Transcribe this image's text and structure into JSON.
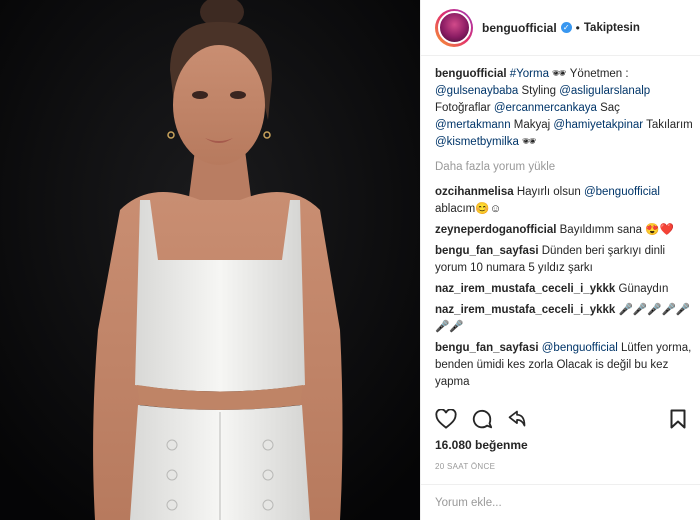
{
  "post": {
    "username": "benguofficial",
    "follow_status": "Takiptesin",
    "separator": "•"
  },
  "caption": {
    "username": "benguofficial",
    "parts": [
      "#Yorma",
      " 🕶 Yönetmen : ",
      "@gulsenaybaba",
      " Styling ",
      "@asligularslanalp",
      " Fotoğraflar ",
      "@ercanmercankaya",
      " Saç ",
      "@mertakmann",
      " Makyaj ",
      "@hamiyetakpinar",
      " Takılarım ",
      "@kismetbymilka",
      " 🕶"
    ]
  },
  "load_more": "Daha fazla yorum yükle",
  "comments": [
    {
      "user": "ozcihanmelisa",
      "text": "Hayırlı olsun ",
      "mention": "@benguofficial",
      "text2": " ablacım😊☺"
    },
    {
      "user": "zeyneperdoganofficial",
      "text": "Bayıldımm sana 😍❤️",
      "mention": "",
      "text2": ""
    },
    {
      "user": "bengu_fan_sayfasi",
      "text": "Dünden beri şarkıyı dinli yorum 10 numara 5 yıldız şarkı",
      "mention": "",
      "text2": ""
    },
    {
      "user": "naz_irem_mustafa_ceceli_i_ykkk",
      "text": "Günaydın",
      "mention": "",
      "text2": ""
    },
    {
      "user": "naz_irem_mustafa_ceceli_i_ykkk",
      "text": "🎤🎤🎤🎤🎤🎤🎤",
      "mention": "",
      "text2": ""
    },
    {
      "user": "bengu_fan_sayfasi",
      "text": "",
      "mention": "@benguofficial",
      "text2": " Lütfen yorma, benden ümidi kes zorla Olacak is değil bu kez yapma"
    }
  ],
  "likes": "16.080 beğenme",
  "time": "20 SAAT ÖNCE",
  "comment_input": {
    "placeholder": "Yorum ekle..."
  },
  "icons": {
    "like": "heart-icon",
    "comment": "comment-icon",
    "share": "share-icon",
    "save": "bookmark-icon"
  },
  "colors": {
    "link": "#003569",
    "verified": "#3897f0",
    "muted": "#999999",
    "photo_bg": "#0b0b0c"
  }
}
